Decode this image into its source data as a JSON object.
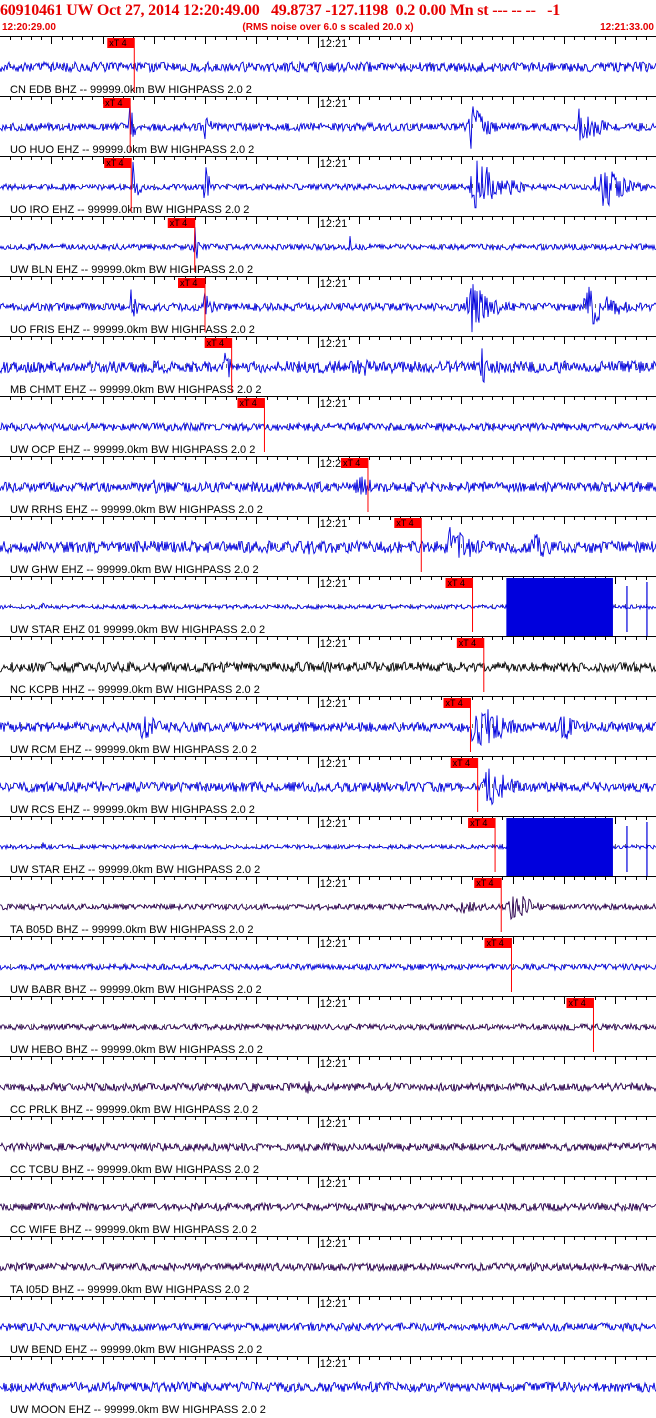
{
  "header": {
    "title": "60910461 UW Oct 27, 2014 12:20:49.00   49.8737 -127.1198  0.2 0.00 Mn st --- -- --   -1",
    "start_time": "12:20:29.00",
    "noise_note": "(RMS noise over 6.0 s scaled 20.0 x)",
    "end_time": "12:21:33.00"
  },
  "colors": {
    "header_text": "#e60000",
    "pick_box": "#ff0000",
    "pick_line": "#ff0000",
    "axis": "#000000",
    "trace_blue": "#0000dd",
    "trace_black": "#000000",
    "trace_purple": "#2a004e"
  },
  "chart_data": {
    "type": "line",
    "title": "60910461 UW Oct 27, 2014 12:20:49.00   49.8737 -127.1198  0.2 0.00 Mn st --- -- --   -1",
    "x_start": "12:20:29.00",
    "x_end": "12:21:33.00",
    "x_range_seconds": [
      0,
      64
    ],
    "minute_tick_label": "12:21",
    "minute_tick_offset_s": 31,
    "pick_label": "xT 4",
    "scale_note": "(RMS noise over 6.0 s scaled 20.0 x)",
    "traces": [
      {
        "label": "CN EDB BHZ -- 99999.0km BW  HIGHPASS  2.0  2",
        "pick_s": 13.1,
        "color": "blue",
        "amp": 5,
        "events": []
      },
      {
        "label": "UO HUO EHZ -- 99999.0km BW  HIGHPASS  2.0  2",
        "pick_s": 12.7,
        "color": "blue",
        "amp": 4,
        "events": [
          [
            12.7,
            0.5,
            28
          ],
          [
            20.0,
            0.5,
            24
          ],
          [
            46.0,
            1.5,
            24
          ],
          [
            56.5,
            2.0,
            20
          ]
        ]
      },
      {
        "label": "UO IRO EHZ -- 99999.0km BW  HIGHPASS  2.0  2",
        "pick_s": 12.8,
        "color": "blue",
        "amp": 3,
        "events": [
          [
            13.0,
            0.5,
            30
          ],
          [
            20.0,
            0.5,
            30
          ],
          [
            46.5,
            2.5,
            30
          ],
          [
            58.5,
            2.0,
            30
          ]
        ]
      },
      {
        "label": "UW BLN EHZ -- 99999.0km BW  HIGHPASS  2.0  2",
        "pick_s": 19.0,
        "color": "blue",
        "amp": 3,
        "events": [
          [
            19.0,
            0.4,
            26
          ],
          [
            34.0,
            0.3,
            20
          ]
        ]
      },
      {
        "label": "UO FRIS EHZ -- 99999.0km BW  HIGHPASS  2.0  2",
        "pick_s": 20.0,
        "color": "blue",
        "amp": 4,
        "events": [
          [
            12.8,
            0.5,
            26
          ],
          [
            20.0,
            0.6,
            26
          ],
          [
            46.0,
            2.0,
            28
          ],
          [
            57.5,
            2.5,
            24
          ]
        ]
      },
      {
        "label": "MB CHMT EHZ -- 99999.0km BW  HIGHPASS  2.0  2",
        "pick_s": 22.6,
        "color": "blue",
        "amp": 6,
        "events": [
          [
            22.0,
            1.0,
            18
          ],
          [
            35.0,
            1.0,
            16
          ],
          [
            47.0,
            0.6,
            26
          ]
        ]
      },
      {
        "label": "UW OCP EHZ -- 99999.0km BW  HIGHPASS  2.0  2",
        "pick_s": 25.8,
        "color": "blue",
        "amp": 4,
        "events": []
      },
      {
        "label": "UW RRHS EHZ -- 99999.0km BW  HIGHPASS  2.0  2",
        "pick_s": 35.9,
        "color": "blue",
        "amp": 5,
        "events": [
          [
            15.0,
            2.0,
            8
          ],
          [
            35.0,
            2.5,
            12
          ],
          [
            41.0,
            1.5,
            8
          ]
        ]
      },
      {
        "label": "UW GHW EHZ -- 99999.0km BW  HIGHPASS  2.0  2",
        "pick_s": 41.1,
        "color": "blue",
        "amp": 6,
        "events": [
          [
            30.0,
            4.0,
            8
          ],
          [
            44.0,
            2.5,
            22
          ],
          [
            52.0,
            2.0,
            16
          ]
        ]
      },
      {
        "label": "UW STAR EHZ 01 99999.0km BW  HIGHPASS  2.0  2",
        "pick_s": 46.1,
        "color": "blue",
        "amp": 2,
        "events": [
          [
            4.2,
            0.3,
            8
          ]
        ],
        "saturated": [
          49.4,
          59.8
        ]
      },
      {
        "label": "NC KCPB HHZ -- 99999.0km BW  HIGHPASS  2.0  2",
        "pick_s": 47.2,
        "color": "black",
        "amp": 5,
        "events": []
      },
      {
        "label": "UW RCM EHZ -- 99999.0km BW  HIGHPASS  2.0  2",
        "pick_s": 45.9,
        "color": "blue",
        "amp": 5,
        "events": [
          [
            14.0,
            2.0,
            14
          ],
          [
            46.5,
            2.5,
            30
          ],
          [
            55.0,
            2.5,
            14
          ]
        ]
      },
      {
        "label": "UW RCS EHZ -- 99999.0km BW  HIGHPASS  2.0  2",
        "pick_s": 46.6,
        "color": "blue",
        "amp": 5,
        "events": [
          [
            9.5,
            1.0,
            10
          ],
          [
            47.5,
            2.0,
            28
          ]
        ]
      },
      {
        "label": "UW STAR EHZ -- 99999.0km BW  HIGHPASS  2.0  2",
        "pick_s": 48.3,
        "color": "blue",
        "amp": 2,
        "events": [
          [
            4.2,
            0.3,
            8
          ]
        ],
        "saturated": [
          49.4,
          59.8
        ]
      },
      {
        "label": "TA B05D BHZ -- 99999.0km BW  HIGHPASS  2.0  2",
        "pick_s": 48.9,
        "color": "purple",
        "amp": 3,
        "events": [
          [
            45.0,
            3.5,
            7
          ],
          [
            50.0,
            2.0,
            18
          ]
        ]
      },
      {
        "label": "UW BABR BHZ -- 99999.0km BW  HIGHPASS  2.0  2",
        "pick_s": 49.9,
        "color": "blue",
        "amp": 3,
        "events": []
      },
      {
        "label": "UW HEBO BHZ -- 99999.0km BW  HIGHPASS  2.0  2",
        "pick_s": 57.9,
        "color": "purple",
        "amp": 3,
        "events": []
      },
      {
        "label": "CC PRLK BHZ -- 99999.0km BW  HIGHPASS  2.0  2",
        "pick_s": null,
        "color": "purple",
        "amp": 4,
        "events": [
          [
            30.0,
            1.0,
            9
          ]
        ]
      },
      {
        "label": "CC TCBU BHZ -- 99999.0km BW  HIGHPASS  2.0  2",
        "pick_s": null,
        "color": "purple",
        "amp": 4,
        "events": []
      },
      {
        "label": "CC WIFE BHZ -- 99999.0km BW  HIGHPASS  2.0  2",
        "pick_s": null,
        "color": "purple",
        "amp": 4,
        "events": []
      },
      {
        "label": "TA I05D BHZ -- 99999.0km BW  HIGHPASS  2.0  2",
        "pick_s": null,
        "color": "purple",
        "amp": 4,
        "events": []
      },
      {
        "label": "UW BEND EHZ -- 99999.0km BW  HIGHPASS  2.0  2",
        "pick_s": null,
        "color": "blue",
        "amp": 4,
        "events": []
      },
      {
        "label": "UW MOON EHZ -- 99999.0km BW  HIGHPASS  2.0  2",
        "pick_s": null,
        "color": "blue",
        "amp": 5,
        "events": []
      }
    ]
  }
}
